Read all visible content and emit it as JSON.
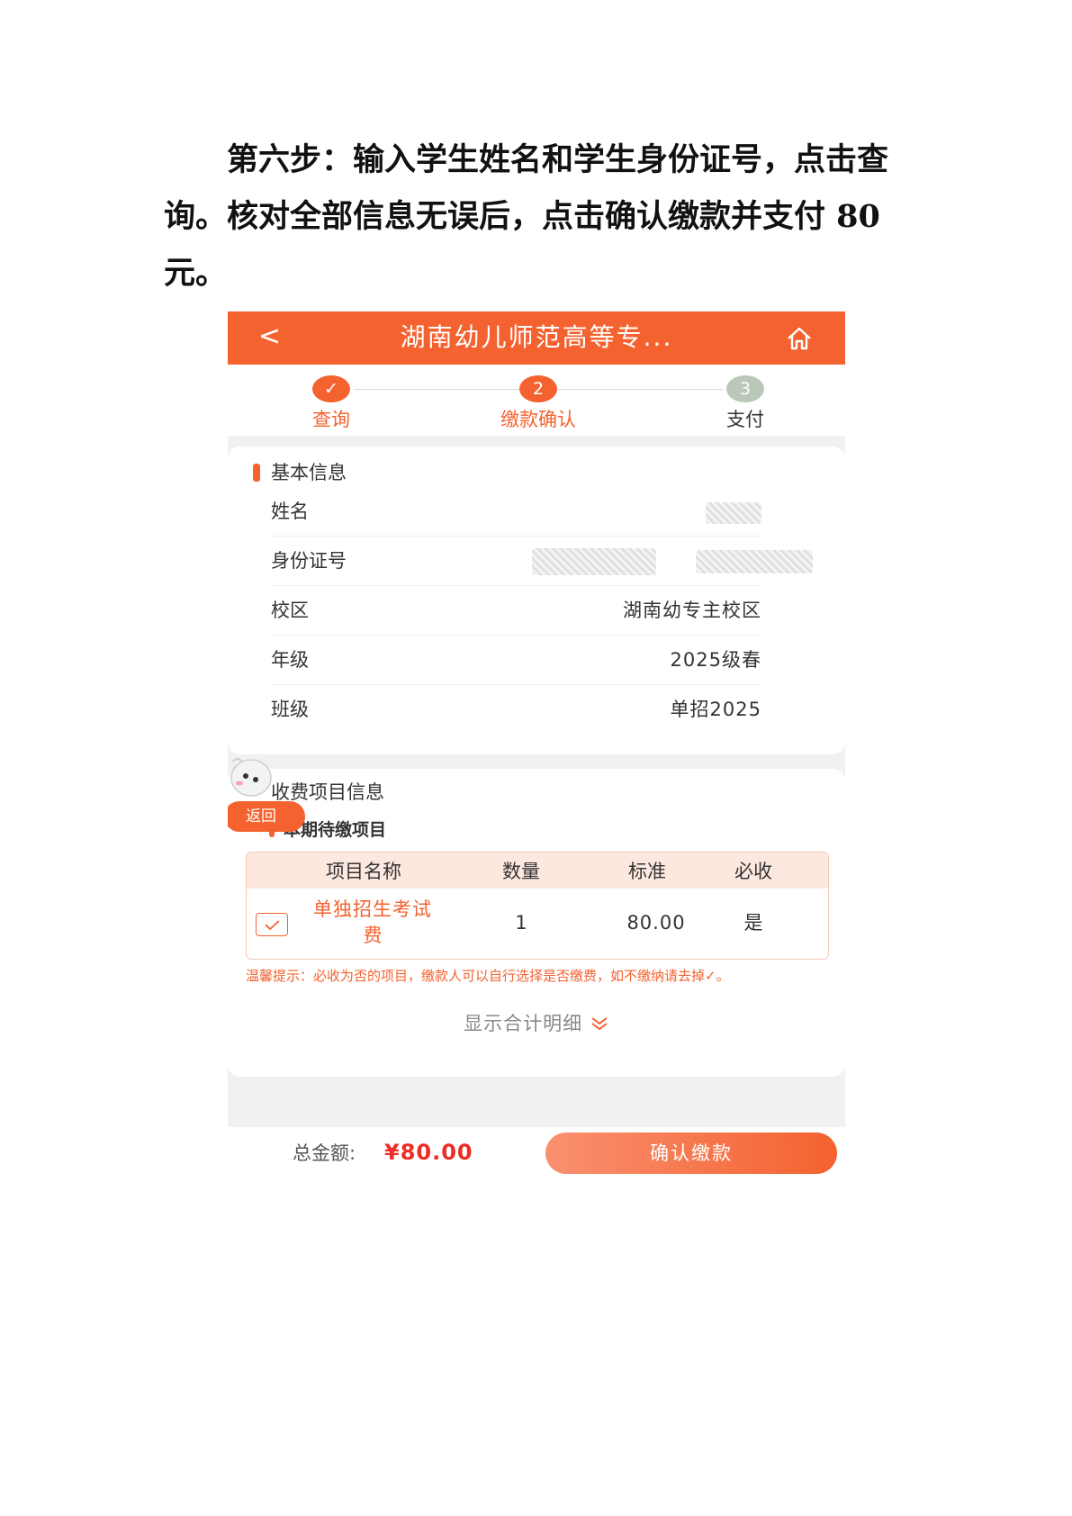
{
  "heading": "第六步：输入学生姓名和学生身份证号，点击查询。核对全部信息无误后，点击确认缴款并支付 80 元。",
  "app": {
    "back_icon": "back-chevron-icon",
    "title": "湖南幼儿师范高等专...",
    "home_icon": "home-icon",
    "accent": "#f4622f"
  },
  "steps": [
    {
      "marker": "✓",
      "label": "查询",
      "state": "done"
    },
    {
      "marker": "2",
      "label": "缴款确认",
      "state": "current"
    },
    {
      "marker": "3",
      "label": "支付",
      "state": "pending"
    }
  ],
  "basic_info": {
    "title": "基本信息",
    "rows": [
      {
        "key": "姓名",
        "value": ""
      },
      {
        "key": "身份证号",
        "value": ""
      },
      {
        "key": "校区",
        "value": "湖南幼专主校区"
      },
      {
        "key": "年级",
        "value": "2025级春"
      },
      {
        "key": "班级",
        "value": "单招2025"
      }
    ]
  },
  "fee_info": {
    "title": "收费项目信息",
    "subtitle": "本期待缴项目",
    "columns": [
      "项目名称",
      "数量",
      "标准",
      "必收"
    ],
    "items": [
      {
        "checked": true,
        "name_line1": "单独招生考试",
        "name_line2": "费",
        "quantity": "1",
        "standard": "80.00",
        "required": "是"
      }
    ],
    "tip": "温馨提示：必收为否的项目，缴款人可以自行选择是否缴费，如不缴纳请去掉✓。",
    "detail_toggle": "显示合计明细",
    "detail_icon": "chevron-double-down-icon"
  },
  "float_back": "返回",
  "bottom": {
    "total_label": "总金额:",
    "total_value": "¥80.00",
    "confirm_button": "确认缴款"
  }
}
